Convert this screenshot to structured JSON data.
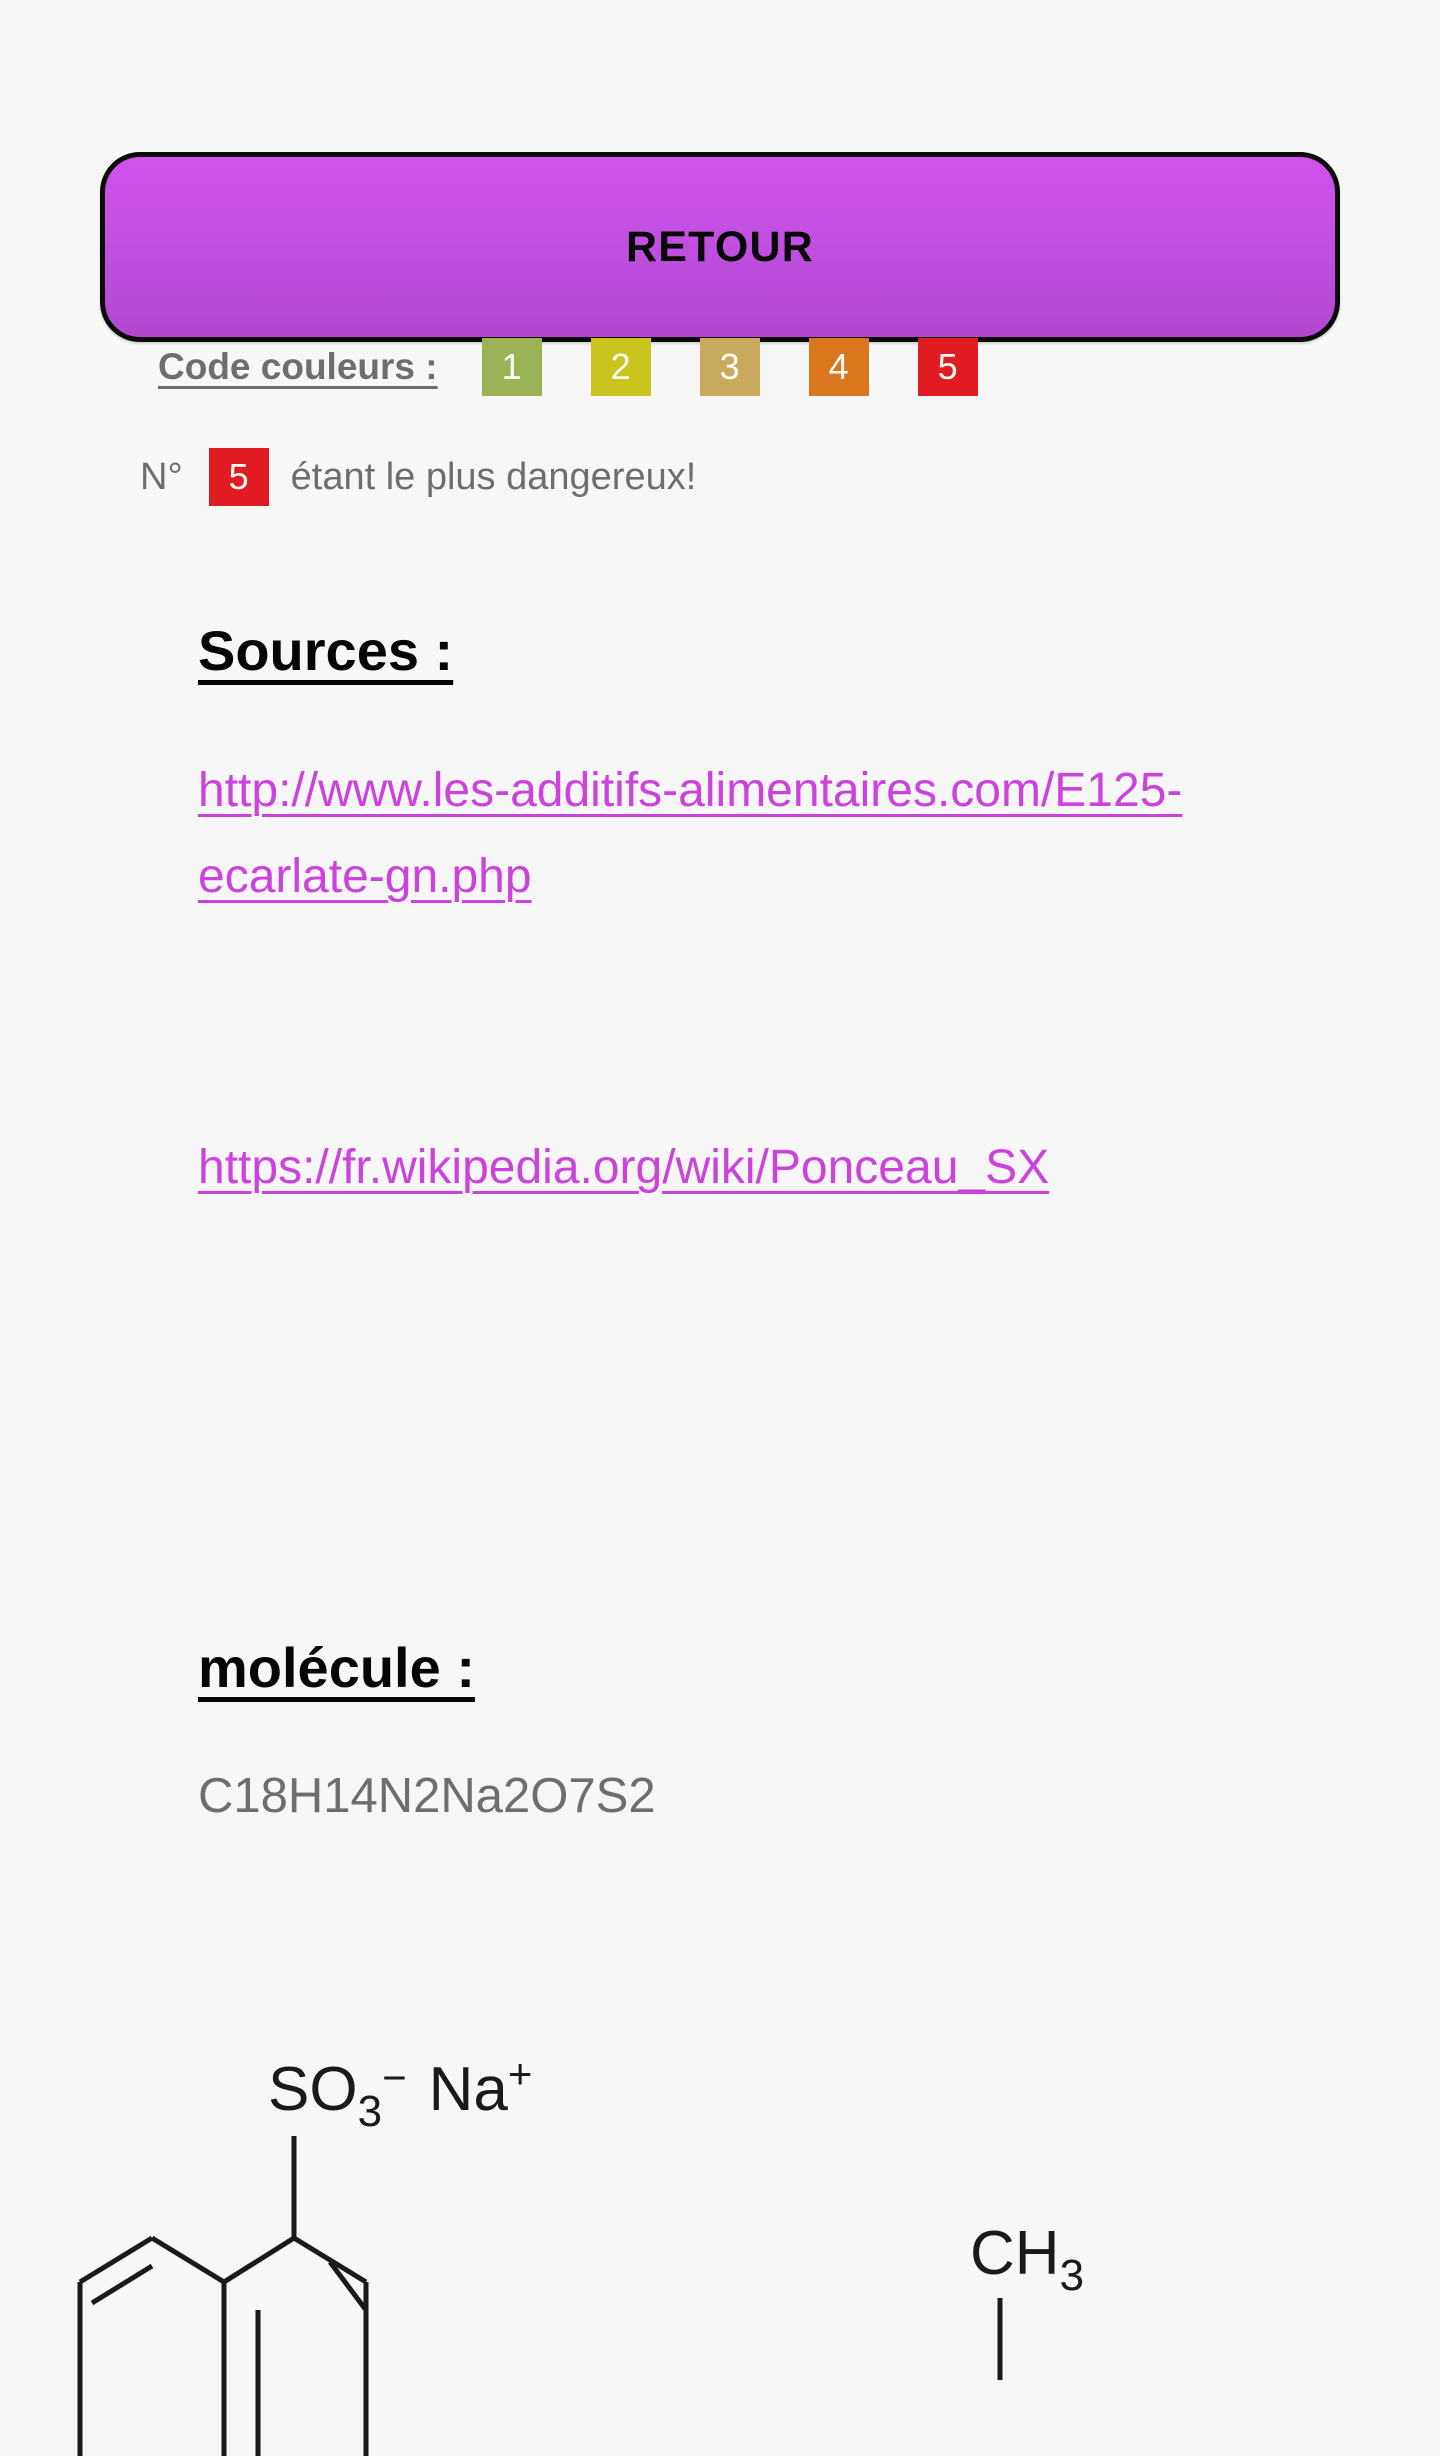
{
  "page": {
    "background_color": "#f7f7f7",
    "language": "fr"
  },
  "back_button": {
    "label": "RETOUR",
    "gradient_top": "#cf52ec",
    "gradient_bottom": "#b248cf",
    "border_color": "#0a0a0a",
    "text_color": "#080808"
  },
  "color_code": {
    "label": "Code couleurs :",
    "label_color": "#6e6e6e",
    "badges": [
      {
        "value": "1",
        "color": "#9bb356"
      },
      {
        "value": "2",
        "color": "#c9c41e"
      },
      {
        "value": "3",
        "color": "#c8a95e"
      },
      {
        "value": "4",
        "color": "#d9761e"
      },
      {
        "value": "5",
        "color": "#e01b22"
      }
    ]
  },
  "danger_note": {
    "prefix": "N°",
    "badge_value": "5",
    "badge_color": "#e01b22",
    "suffix": "étant le plus dangereux!",
    "text_color": "#6e6e6e"
  },
  "sources": {
    "heading": "Sources :",
    "link_color": "#cc42dd",
    "links": [
      {
        "text": "http://www.les-additifs-alimentaires.com/E125-ecarlate-gn.php"
      },
      {
        "text": "https://fr.wikipedia.org/wiki/Ponceau_SX"
      }
    ]
  },
  "molecule": {
    "heading": "molécule :",
    "formula": "C18H14N2Na2O7S2",
    "formula_color": "#6e6e6e",
    "diagram": {
      "sulfonate_label": "SO",
      "sulfonate_sub": "3",
      "sulfonate_charge": "−",
      "sodium_label": "Na",
      "sodium_charge": "+",
      "methyl_label": "CH",
      "methyl_sub": "3",
      "stroke_color": "#1a1a1a"
    }
  }
}
